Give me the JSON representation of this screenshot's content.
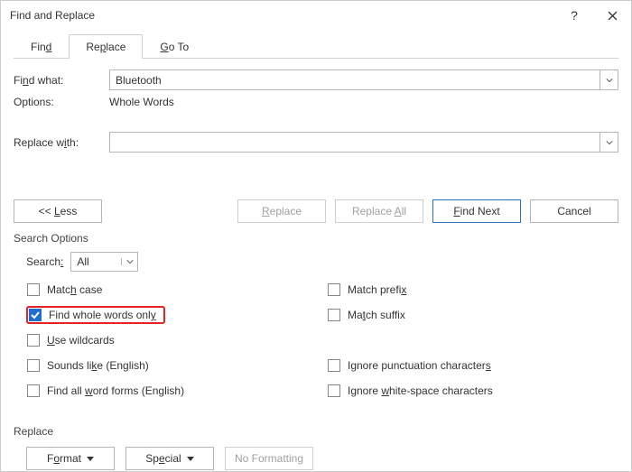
{
  "titlebar": {
    "title": "Find and Replace"
  },
  "tabs": {
    "find": "Find",
    "replace": "Replace",
    "goto": "Go To"
  },
  "labels": {
    "find_what": "Find what:",
    "options": "Options:",
    "options_value": "Whole Words",
    "replace_with": "Replace with:"
  },
  "find_value": "Bluetooth",
  "replace_value": "",
  "buttons": {
    "less": "<<  Less",
    "replace": "Replace",
    "replace_all": "Replace All",
    "find_next": "Find Next",
    "cancel": "Cancel",
    "format": "Format",
    "special": "Special",
    "no_formatting": "No Formatting"
  },
  "section_search_options": "Search Options",
  "search_label": "Search:",
  "search_dir": "All",
  "checks": {
    "match_case": "Match case",
    "whole_words": "Find whole words only",
    "wildcards": "Use wildcards",
    "sounds_like": "Sounds like (English)",
    "word_forms": "Find all word forms (English)",
    "match_prefix": "Match prefix",
    "match_suffix": "Match suffix",
    "ignore_punct": "Ignore punctuation characters",
    "ignore_ws": "Ignore white-space characters"
  },
  "section_replace": "Replace"
}
